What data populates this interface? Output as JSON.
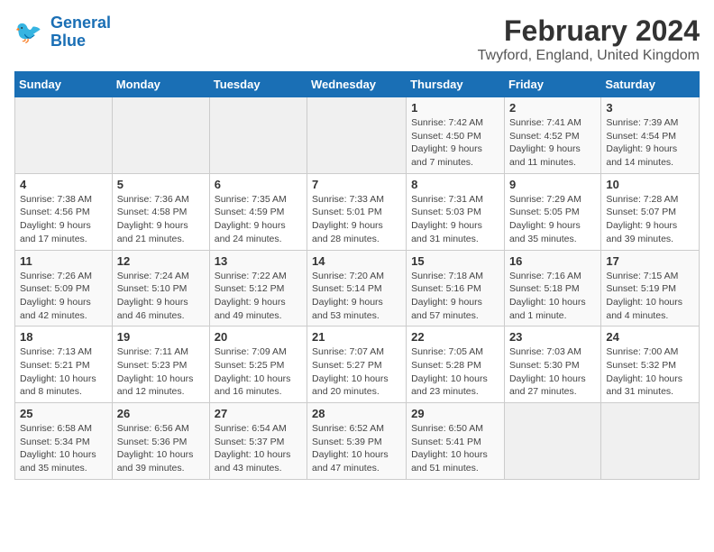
{
  "header": {
    "logo_general": "General",
    "logo_blue": "Blue",
    "month_year": "February 2024",
    "location": "Twyford, England, United Kingdom"
  },
  "weekdays": [
    "Sunday",
    "Monday",
    "Tuesday",
    "Wednesday",
    "Thursday",
    "Friday",
    "Saturday"
  ],
  "weeks": [
    [
      {
        "day": "",
        "info": ""
      },
      {
        "day": "",
        "info": ""
      },
      {
        "day": "",
        "info": ""
      },
      {
        "day": "",
        "info": ""
      },
      {
        "day": "1",
        "info": "Sunrise: 7:42 AM\nSunset: 4:50 PM\nDaylight: 9 hours\nand 7 minutes."
      },
      {
        "day": "2",
        "info": "Sunrise: 7:41 AM\nSunset: 4:52 PM\nDaylight: 9 hours\nand 11 minutes."
      },
      {
        "day": "3",
        "info": "Sunrise: 7:39 AM\nSunset: 4:54 PM\nDaylight: 9 hours\nand 14 minutes."
      }
    ],
    [
      {
        "day": "4",
        "info": "Sunrise: 7:38 AM\nSunset: 4:56 PM\nDaylight: 9 hours\nand 17 minutes."
      },
      {
        "day": "5",
        "info": "Sunrise: 7:36 AM\nSunset: 4:58 PM\nDaylight: 9 hours\nand 21 minutes."
      },
      {
        "day": "6",
        "info": "Sunrise: 7:35 AM\nSunset: 4:59 PM\nDaylight: 9 hours\nand 24 minutes."
      },
      {
        "day": "7",
        "info": "Sunrise: 7:33 AM\nSunset: 5:01 PM\nDaylight: 9 hours\nand 28 minutes."
      },
      {
        "day": "8",
        "info": "Sunrise: 7:31 AM\nSunset: 5:03 PM\nDaylight: 9 hours\nand 31 minutes."
      },
      {
        "day": "9",
        "info": "Sunrise: 7:29 AM\nSunset: 5:05 PM\nDaylight: 9 hours\nand 35 minutes."
      },
      {
        "day": "10",
        "info": "Sunrise: 7:28 AM\nSunset: 5:07 PM\nDaylight: 9 hours\nand 39 minutes."
      }
    ],
    [
      {
        "day": "11",
        "info": "Sunrise: 7:26 AM\nSunset: 5:09 PM\nDaylight: 9 hours\nand 42 minutes."
      },
      {
        "day": "12",
        "info": "Sunrise: 7:24 AM\nSunset: 5:10 PM\nDaylight: 9 hours\nand 46 minutes."
      },
      {
        "day": "13",
        "info": "Sunrise: 7:22 AM\nSunset: 5:12 PM\nDaylight: 9 hours\nand 49 minutes."
      },
      {
        "day": "14",
        "info": "Sunrise: 7:20 AM\nSunset: 5:14 PM\nDaylight: 9 hours\nand 53 minutes."
      },
      {
        "day": "15",
        "info": "Sunrise: 7:18 AM\nSunset: 5:16 PM\nDaylight: 9 hours\nand 57 minutes."
      },
      {
        "day": "16",
        "info": "Sunrise: 7:16 AM\nSunset: 5:18 PM\nDaylight: 10 hours\nand 1 minute."
      },
      {
        "day": "17",
        "info": "Sunrise: 7:15 AM\nSunset: 5:19 PM\nDaylight: 10 hours\nand 4 minutes."
      }
    ],
    [
      {
        "day": "18",
        "info": "Sunrise: 7:13 AM\nSunset: 5:21 PM\nDaylight: 10 hours\nand 8 minutes."
      },
      {
        "day": "19",
        "info": "Sunrise: 7:11 AM\nSunset: 5:23 PM\nDaylight: 10 hours\nand 12 minutes."
      },
      {
        "day": "20",
        "info": "Sunrise: 7:09 AM\nSunset: 5:25 PM\nDaylight: 10 hours\nand 16 minutes."
      },
      {
        "day": "21",
        "info": "Sunrise: 7:07 AM\nSunset: 5:27 PM\nDaylight: 10 hours\nand 20 minutes."
      },
      {
        "day": "22",
        "info": "Sunrise: 7:05 AM\nSunset: 5:28 PM\nDaylight: 10 hours\nand 23 minutes."
      },
      {
        "day": "23",
        "info": "Sunrise: 7:03 AM\nSunset: 5:30 PM\nDaylight: 10 hours\nand 27 minutes."
      },
      {
        "day": "24",
        "info": "Sunrise: 7:00 AM\nSunset: 5:32 PM\nDaylight: 10 hours\nand 31 minutes."
      }
    ],
    [
      {
        "day": "25",
        "info": "Sunrise: 6:58 AM\nSunset: 5:34 PM\nDaylight: 10 hours\nand 35 minutes."
      },
      {
        "day": "26",
        "info": "Sunrise: 6:56 AM\nSunset: 5:36 PM\nDaylight: 10 hours\nand 39 minutes."
      },
      {
        "day": "27",
        "info": "Sunrise: 6:54 AM\nSunset: 5:37 PM\nDaylight: 10 hours\nand 43 minutes."
      },
      {
        "day": "28",
        "info": "Sunrise: 6:52 AM\nSunset: 5:39 PM\nDaylight: 10 hours\nand 47 minutes."
      },
      {
        "day": "29",
        "info": "Sunrise: 6:50 AM\nSunset: 5:41 PM\nDaylight: 10 hours\nand 51 minutes."
      },
      {
        "day": "",
        "info": ""
      },
      {
        "day": "",
        "info": ""
      }
    ]
  ]
}
